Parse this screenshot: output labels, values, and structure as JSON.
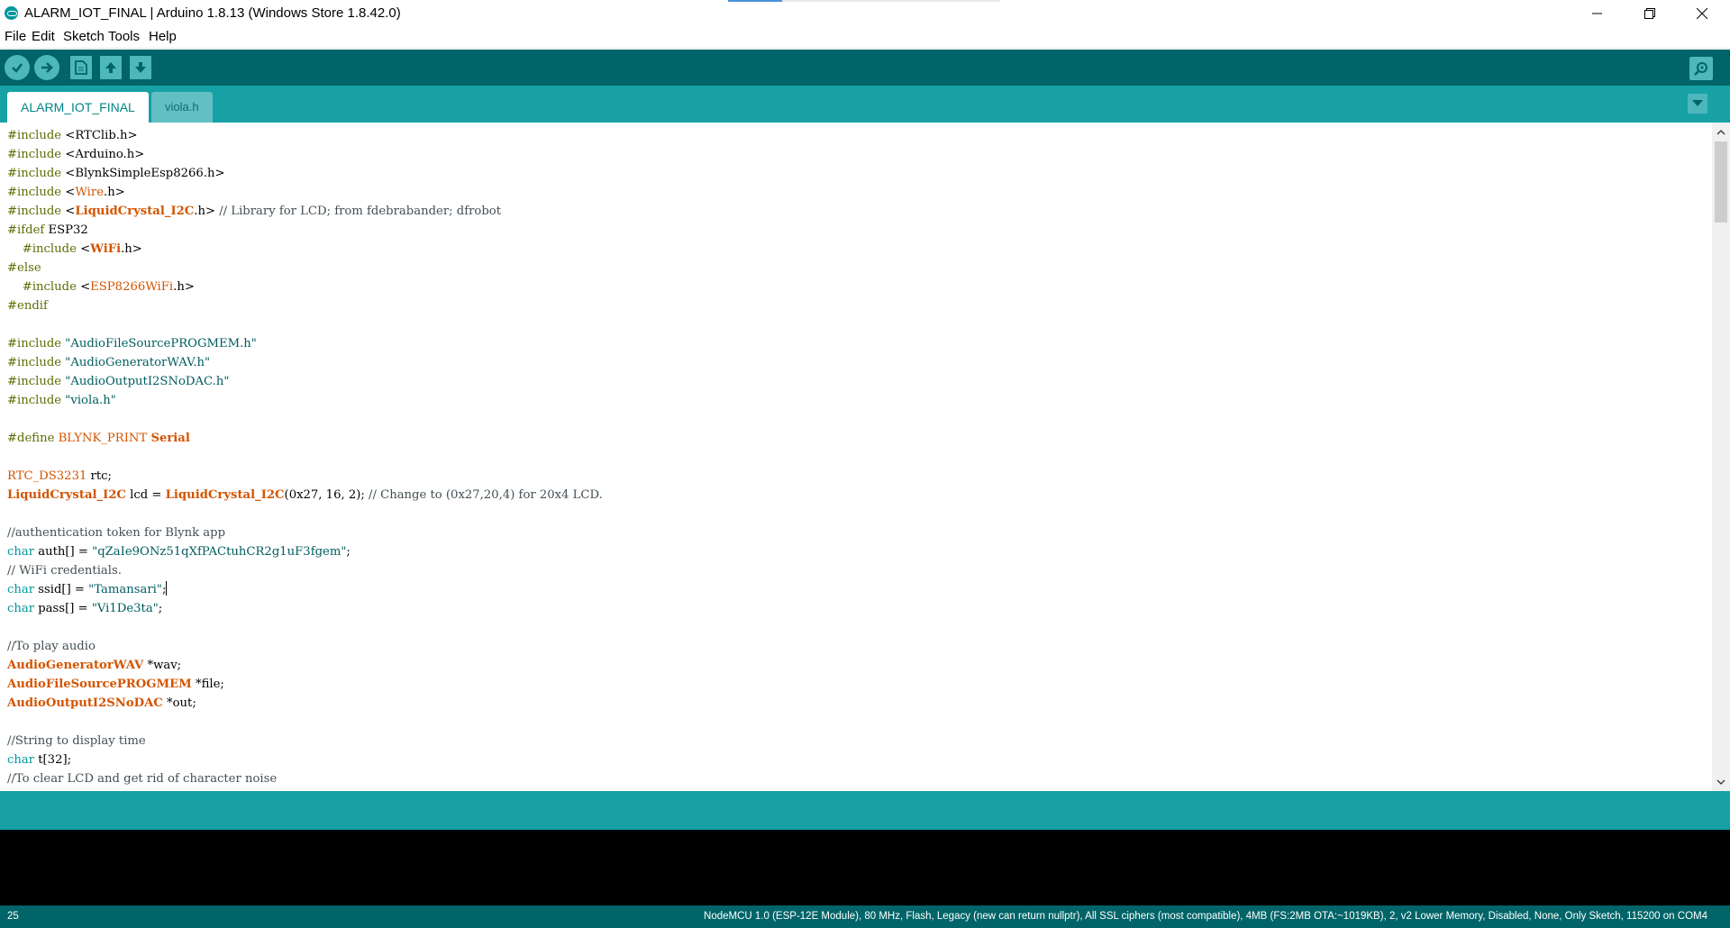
{
  "window": {
    "title": "ALARM_IOT_FINAL | Arduino 1.8.13 (Windows Store 1.8.42.0)",
    "controls": [
      "minimize-icon",
      "restore-icon",
      "close-icon"
    ]
  },
  "menu": {
    "file": "File",
    "edit": "Edit",
    "sketch": "Sketch",
    "tools": "Tools",
    "help": "Help"
  },
  "toolbar": {
    "buttons": [
      "verify-icon",
      "upload-icon",
      "new-icon",
      "open-icon",
      "save-icon"
    ],
    "serial_monitor": "serial-monitor-icon"
  },
  "tabs": [
    {
      "label": "ALARM_IOT_FINAL",
      "active": true
    },
    {
      "label": "viola.h",
      "active": false
    }
  ],
  "editor": {
    "lines": [
      [
        [
          "pre",
          "#include "
        ],
        [
          "plain",
          "<RTClib.h>"
        ]
      ],
      [
        [
          "pre",
          "#include "
        ],
        [
          "plain",
          "<Arduino.h>"
        ]
      ],
      [
        [
          "pre",
          "#include "
        ],
        [
          "plain",
          "<BlynkSimpleEsp8266.h>"
        ]
      ],
      [
        [
          "pre",
          "#include "
        ],
        [
          "plain",
          "<"
        ],
        [
          "lib",
          "Wire"
        ],
        [
          "plain",
          ".h>"
        ]
      ],
      [
        [
          "pre",
          "#include "
        ],
        [
          "plain",
          "<"
        ],
        [
          "class",
          "LiquidCrystal_I2C"
        ],
        [
          "plain",
          ".h> "
        ],
        [
          "cmt",
          "// Library for LCD; from fdebrabander; dfrobot"
        ]
      ],
      [
        [
          "pre",
          "#ifdef "
        ],
        [
          "plain",
          "ESP32"
        ]
      ],
      [
        [
          "plain",
          "    "
        ],
        [
          "pre",
          "#include "
        ],
        [
          "plain",
          "<"
        ],
        [
          "class",
          "WiFi"
        ],
        [
          "plain",
          ".h>"
        ]
      ],
      [
        [
          "pre",
          "#else"
        ]
      ],
      [
        [
          "plain",
          "    "
        ],
        [
          "pre",
          "#include "
        ],
        [
          "plain",
          "<"
        ],
        [
          "lib",
          "ESP8266WiFi"
        ],
        [
          "plain",
          ".h>"
        ]
      ],
      [
        [
          "pre",
          "#endif"
        ]
      ],
      [],
      [
        [
          "pre",
          "#include "
        ],
        [
          "str",
          "\"AudioFileSourcePROGMEM.h\""
        ]
      ],
      [
        [
          "pre",
          "#include "
        ],
        [
          "str",
          "\"AudioGeneratorWAV.h\""
        ]
      ],
      [
        [
          "pre",
          "#include "
        ],
        [
          "str",
          "\"AudioOutputI2SNoDAC.h\""
        ]
      ],
      [
        [
          "pre",
          "#include "
        ],
        [
          "str",
          "\"viola.h\""
        ]
      ],
      [],
      [
        [
          "pre",
          "#define "
        ],
        [
          "lib",
          "BLYNK_PRINT "
        ],
        [
          "class",
          "Serial"
        ]
      ],
      [],
      [
        [
          "lib",
          "RTC_DS3231"
        ],
        [
          "plain",
          " rtc;"
        ]
      ],
      [
        [
          "class",
          "LiquidCrystal_I2C"
        ],
        [
          "plain",
          " lcd = "
        ],
        [
          "class",
          "LiquidCrystal_I2C"
        ],
        [
          "plain",
          "(0x27, 16, 2); "
        ],
        [
          "cmt",
          "// Change to (0x27,20,4) for 20x4 LCD."
        ]
      ],
      [],
      [
        [
          "cmt",
          "//authentication token for Blynk app"
        ]
      ],
      [
        [
          "type",
          "char"
        ],
        [
          "plain",
          " auth[] = "
        ],
        [
          "str",
          "\"qZaIe9ONz51qXfPACtuhCR2g1uF3fgem\""
        ],
        [
          "plain",
          ";"
        ]
      ],
      [
        [
          "cmt",
          "// WiFi credentials."
        ]
      ],
      [
        [
          "type",
          "char"
        ],
        [
          "plain",
          " ssid[] = "
        ],
        [
          "str",
          "\"Tamansari\""
        ],
        [
          "plain",
          ";"
        ],
        [
          "caret",
          ""
        ]
      ],
      [
        [
          "type",
          "char"
        ],
        [
          "plain",
          " pass[] = "
        ],
        [
          "str",
          "\"Vi1De3ta\""
        ],
        [
          "plain",
          ";"
        ]
      ],
      [],
      [
        [
          "cmt",
          "//To play audio"
        ]
      ],
      [
        [
          "class",
          "AudioGeneratorWAV"
        ],
        [
          "plain",
          " *wav;"
        ]
      ],
      [
        [
          "class",
          "AudioFileSourcePROGMEM"
        ],
        [
          "plain",
          " *file;"
        ]
      ],
      [
        [
          "class",
          "AudioOutputI2SNoDAC"
        ],
        [
          "plain",
          " *out;"
        ]
      ],
      [],
      [
        [
          "cmt",
          "//String to display time"
        ]
      ],
      [
        [
          "type",
          "char"
        ],
        [
          "plain",
          " t[32];"
        ]
      ],
      [
        [
          "cmt",
          "//To clear LCD and get rid of character noise"
        ]
      ]
    ]
  },
  "status": {
    "line_number": "25",
    "board_info": "NodeMCU 1.0 (ESP-12E Module), 80 MHz, Flash, Legacy (new can return nullptr), All SSL ciphers (most compatible), 4MB (FS:2MB OTA:~1019KB), 2, v2 Lower Memory, Disabled, None, Only Sketch, 115200 on COM4"
  },
  "colors": {
    "toolbar": "#006468",
    "tabs_bar": "#17a1a5",
    "preprocessor": "#5e6d03",
    "type": "#00979c",
    "class": "#d35400",
    "comment": "#434f54",
    "string": "#005c5f"
  }
}
